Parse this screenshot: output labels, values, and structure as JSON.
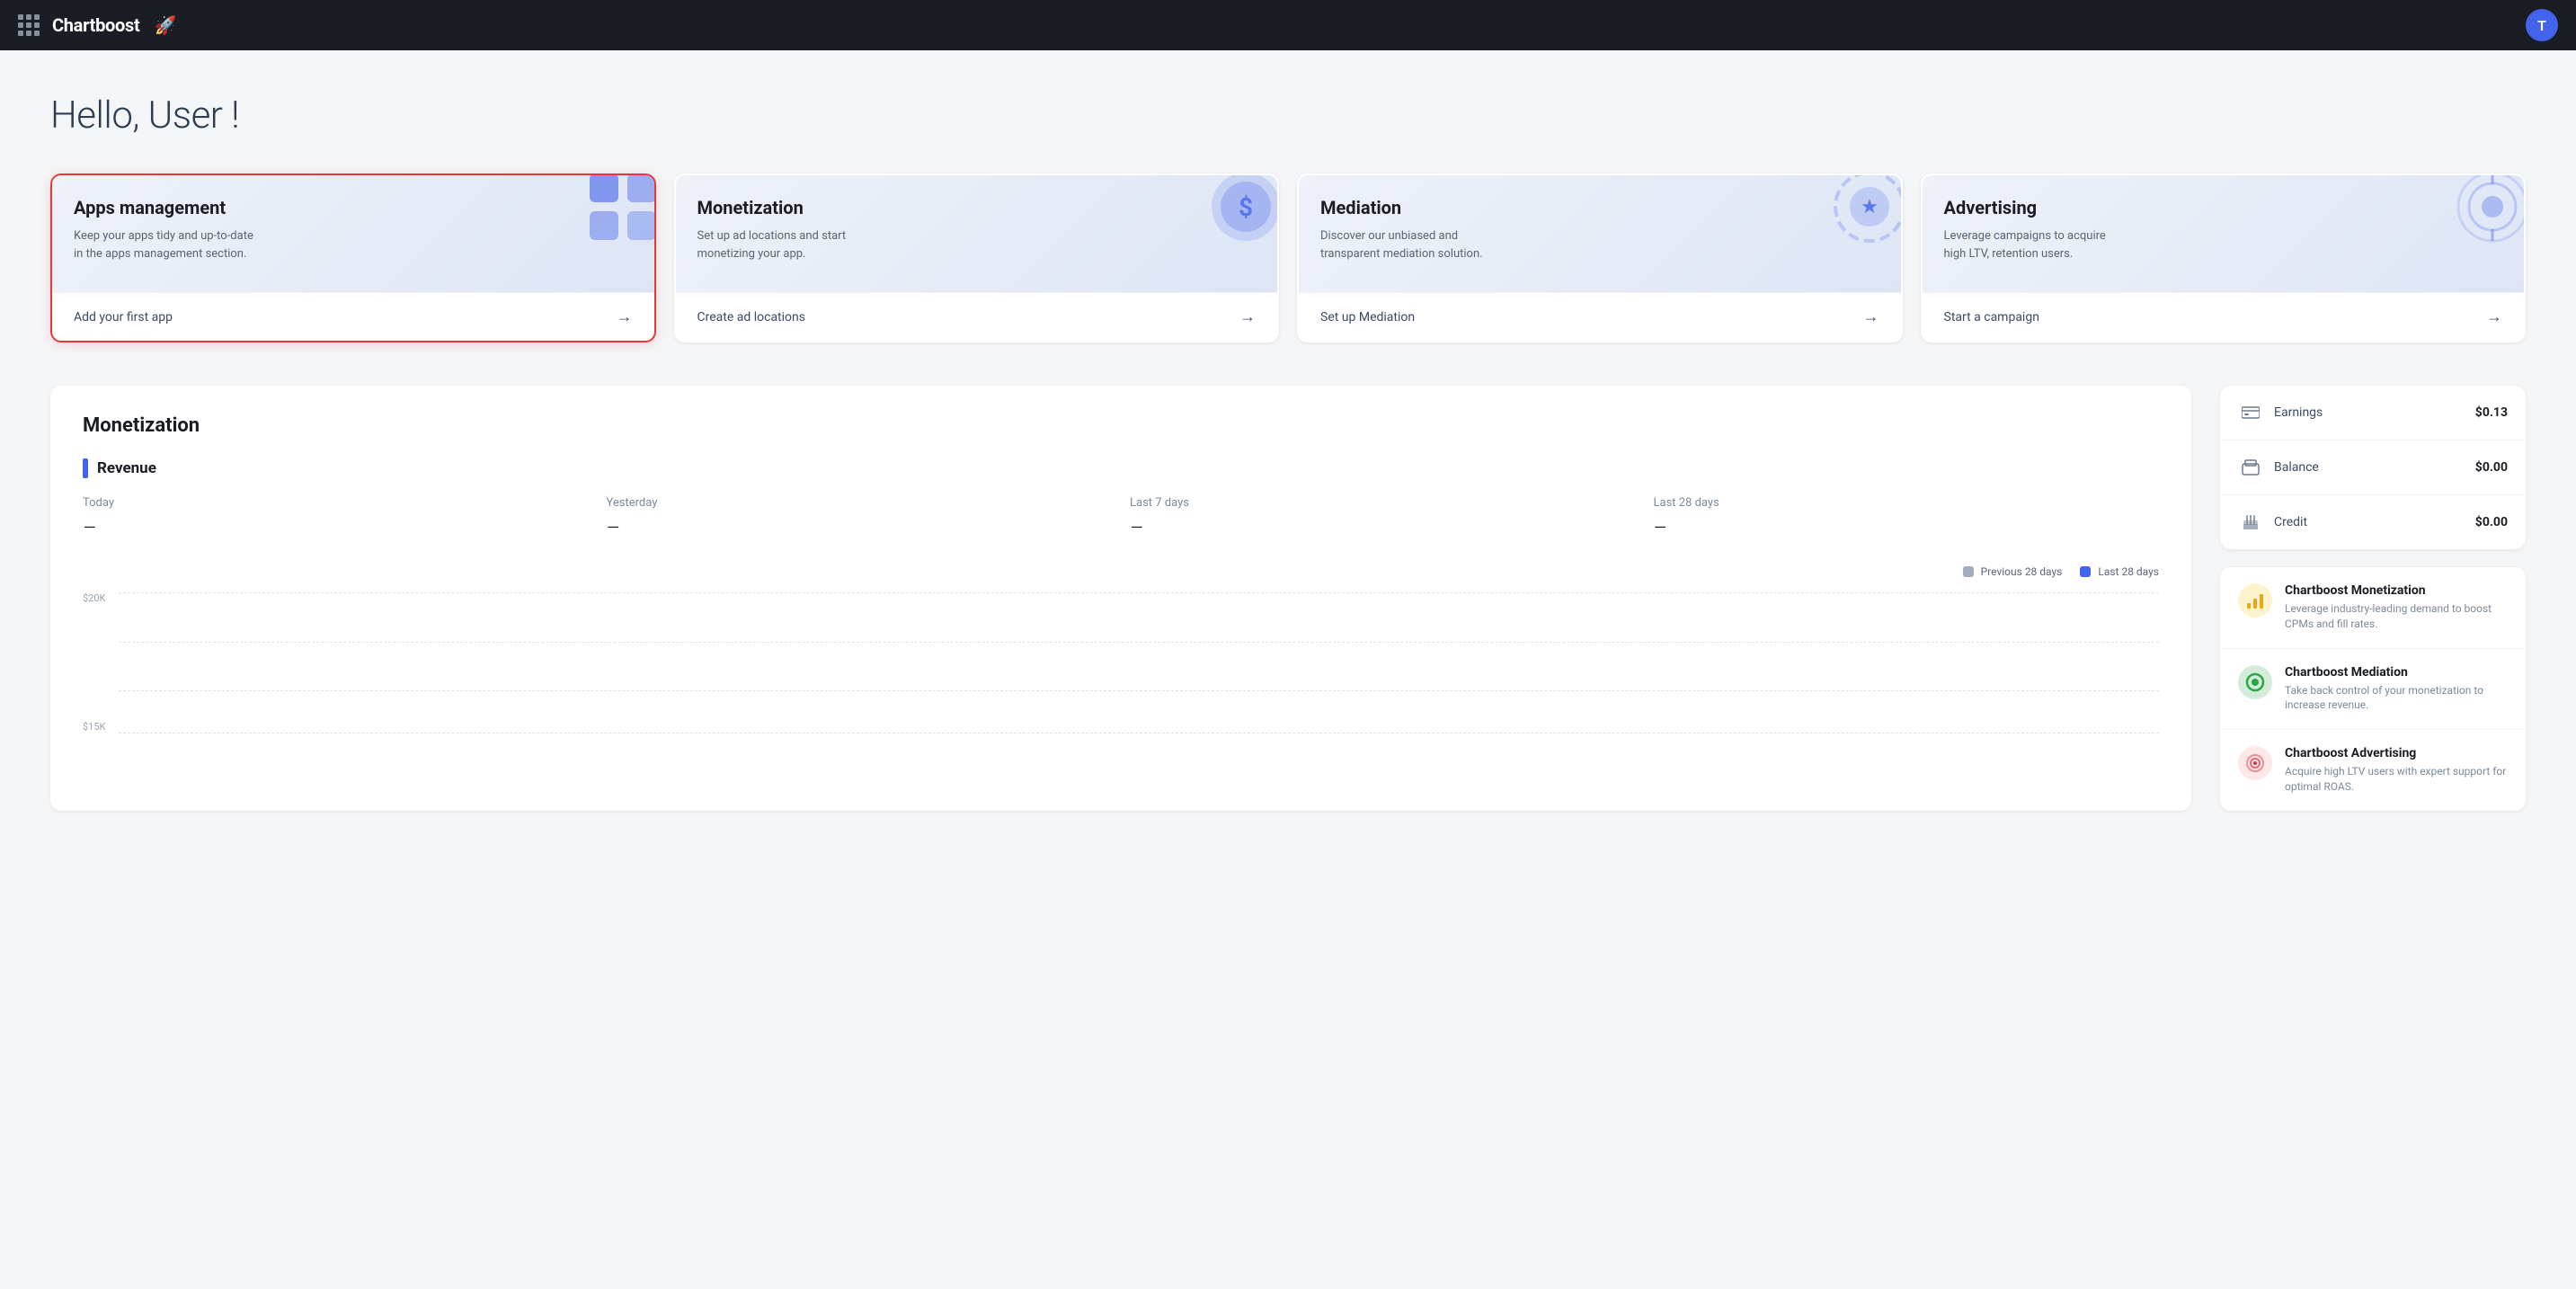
{
  "header": {
    "app_name": "Chartboost",
    "logo_icon": "🚀",
    "avatar_letter": "T"
  },
  "greeting": "Hello, User !",
  "cards": [
    {
      "id": "apps-management",
      "title": "Apps management",
      "description": "Keep your apps tidy and up-to-date in the apps management section.",
      "link": "Add your first app",
      "icon": "🗂️",
      "active": true
    },
    {
      "id": "monetization",
      "title": "Monetization",
      "description": "Set up ad locations and start monetizing your app.",
      "link": "Create ad locations",
      "icon": "💰",
      "active": false
    },
    {
      "id": "mediation",
      "title": "Mediation",
      "description": "Discover our unbiased and transparent mediation solution.",
      "link": "Set up Mediation",
      "icon": "⭐",
      "active": false
    },
    {
      "id": "advertising",
      "title": "Advertising",
      "description": "Leverage campaigns to acquire high LTV, retention users.",
      "link": "Start a campaign",
      "icon": "🎯",
      "active": false
    }
  ],
  "monetization": {
    "title": "Monetization",
    "revenue": {
      "label": "Revenue",
      "stats": [
        {
          "period": "Today",
          "value": "–"
        },
        {
          "period": "Yesterday",
          "value": "–"
        },
        {
          "period": "Last 7 days",
          "value": "–"
        },
        {
          "period": "Last 28 days",
          "value": "–"
        }
      ]
    },
    "chart": {
      "y_labels": [
        "$20K",
        "$15K"
      ],
      "legend": [
        {
          "label": "Previous 28 days",
          "color": "#a0aec0"
        },
        {
          "label": "Last 28 days",
          "color": "#4263eb"
        }
      ]
    }
  },
  "finance": {
    "rows": [
      {
        "label": "Earnings",
        "value": "$0.13",
        "icon": "💳"
      },
      {
        "label": "Balance",
        "value": "$0.00",
        "icon": "🏦"
      },
      {
        "label": "Credit",
        "value": "$0.00",
        "icon": "🏛️"
      }
    ]
  },
  "promos": [
    {
      "title": "Chartboost Monetization",
      "description": "Leverage industry-leading demand to boost CPMs and fill rates.",
      "icon": "📊",
      "icon_class": "promo-icon-yellow"
    },
    {
      "title": "Chartboost Mediation",
      "description": "Take back control of your monetization to increase revenue.",
      "icon": "🟢",
      "icon_class": "promo-icon-green"
    },
    {
      "title": "Chartboost Advertising",
      "description": "Acquire high LTV users with expert support for optimal ROAS.",
      "icon": "🎯",
      "icon_class": "promo-icon-red"
    }
  ]
}
